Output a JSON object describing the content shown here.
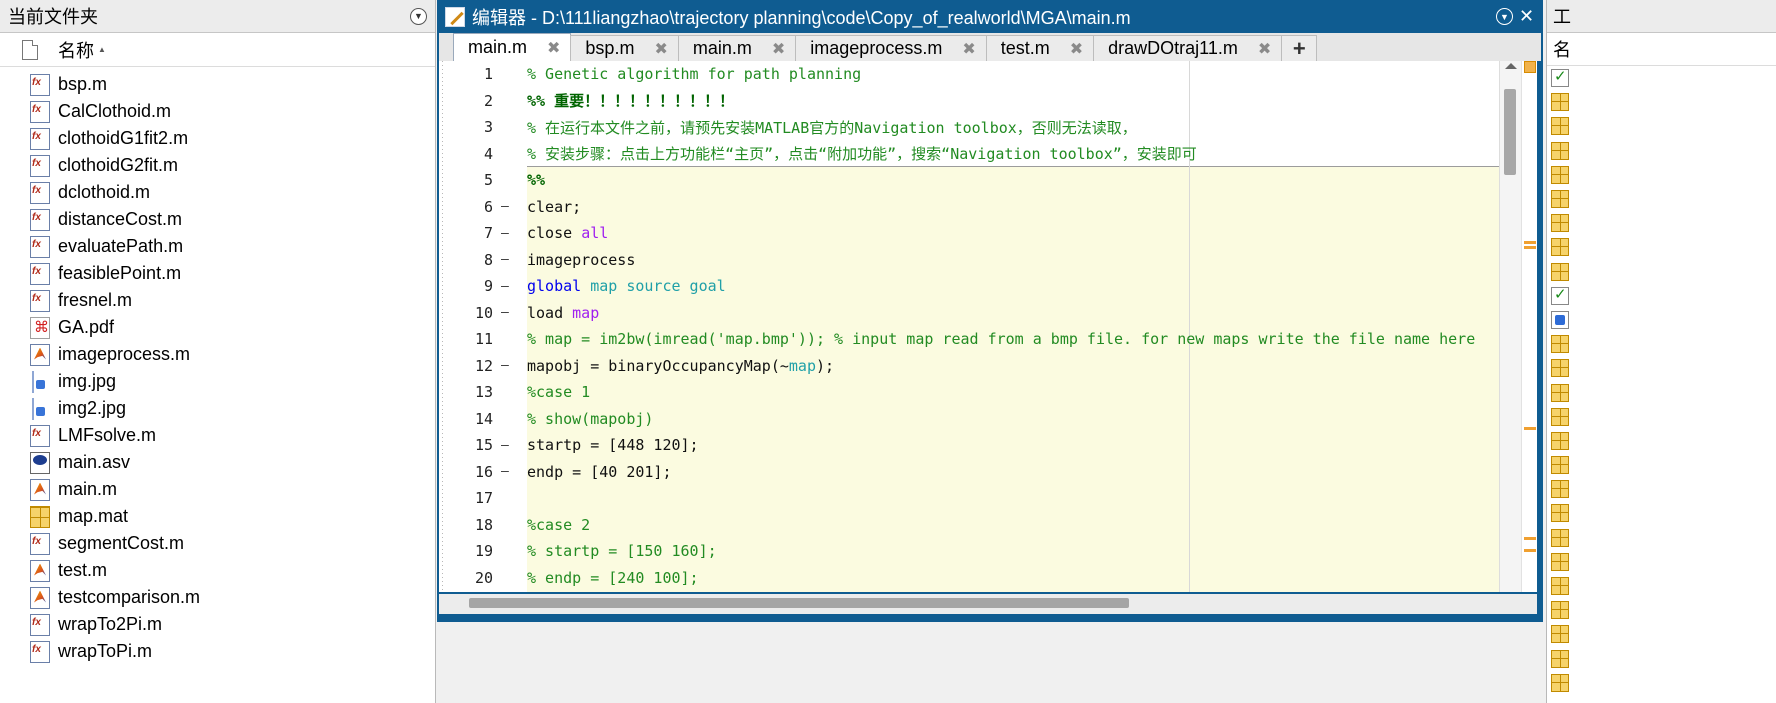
{
  "folder_panel": {
    "title": "当前文件夹",
    "column_name": "名称",
    "sort_arrow": "▲",
    "files": [
      {
        "name": "bsp.m",
        "icon": "function-file-icon"
      },
      {
        "name": "CalClothoid.m",
        "icon": "function-file-icon"
      },
      {
        "name": "clothoidG1fit2.m",
        "icon": "function-file-icon"
      },
      {
        "name": "clothoidG2fit.m",
        "icon": "function-file-icon"
      },
      {
        "name": "dclothoid.m",
        "icon": "function-file-icon"
      },
      {
        "name": "distanceCost.m",
        "icon": "function-file-icon"
      },
      {
        "name": "evaluatePath.m",
        "icon": "function-file-icon"
      },
      {
        "name": "feasiblePoint.m",
        "icon": "function-file-icon"
      },
      {
        "name": "fresnel.m",
        "icon": "function-file-icon"
      },
      {
        "name": "GA.pdf",
        "icon": "pdf-file-icon"
      },
      {
        "name": "imageprocess.m",
        "icon": "script-file-icon"
      },
      {
        "name": "img.jpg",
        "icon": "image-file-icon"
      },
      {
        "name": "img2.jpg",
        "icon": "image-file-icon"
      },
      {
        "name": "LMFsolve.m",
        "icon": "function-file-icon"
      },
      {
        "name": "main.asv",
        "icon": "autosave-file-icon"
      },
      {
        "name": "main.m",
        "icon": "script-file-icon"
      },
      {
        "name": "map.mat",
        "icon": "mat-file-icon"
      },
      {
        "name": "segmentCost.m",
        "icon": "function-file-icon"
      },
      {
        "name": "test.m",
        "icon": "script-file-icon"
      },
      {
        "name": "testcomparison.m",
        "icon": "script-file-icon"
      },
      {
        "name": "wrapTo2Pi.m",
        "icon": "function-file-icon"
      },
      {
        "name": "wrapToPi.m",
        "icon": "function-file-icon"
      }
    ]
  },
  "editor": {
    "title": "编辑器 - D:\\111liangzhao\\trajectory planning\\code\\Copy_of_realworld\\MGA\\main.m",
    "tabs": [
      {
        "label": "main.m",
        "active": true
      },
      {
        "label": "bsp.m",
        "active": false
      },
      {
        "label": "main.m",
        "active": false
      },
      {
        "label": "imageprocess.m",
        "active": false
      },
      {
        "label": "test.m",
        "active": false
      },
      {
        "label": "drawDOtraj11.m",
        "active": false
      }
    ],
    "tab_close_glyph": "✖",
    "tab_add_glyph": "+",
    "menu_glyph": "▼",
    "close_glyph": "✕",
    "lines": [
      {
        "n": "1",
        "dash": "",
        "tokens": [
          {
            "t": "% Genetic algorithm for path planning",
            "c": "cm"
          }
        ]
      },
      {
        "n": "2",
        "dash": "",
        "tokens": [
          {
            "t": "%% 重要！！！！！！！！！！",
            "c": "cell"
          }
        ]
      },
      {
        "n": "3",
        "dash": "",
        "tokens": [
          {
            "t": "% 在运行本文件之前，请预先安装MATLAB官方的Navigation toolbox，否则无法读取，",
            "c": "cm"
          }
        ]
      },
      {
        "n": "4",
        "dash": "",
        "tokens": [
          {
            "t": "% 安装步骤：点击上方功能栏“主页”，点击“附加功能”，搜索“Navigation toolbox”，安装即可",
            "c": "cm"
          }
        ]
      },
      {
        "n": "5",
        "dash": "",
        "tokens": [
          {
            "t": "%%",
            "c": "cell"
          }
        ]
      },
      {
        "n": "6",
        "dash": "—",
        "tokens": [
          {
            "t": "clear;",
            "c": "plain"
          }
        ]
      },
      {
        "n": "7",
        "dash": "—",
        "tokens": [
          {
            "t": "close ",
            "c": "plain"
          },
          {
            "t": "all",
            "c": "str"
          }
        ]
      },
      {
        "n": "8",
        "dash": "—",
        "tokens": [
          {
            "t": "imageprocess",
            "c": "plain"
          }
        ]
      },
      {
        "n": "9",
        "dash": "—",
        "tokens": [
          {
            "t": "global ",
            "c": "kw"
          },
          {
            "t": "map source goal",
            "c": "var"
          }
        ]
      },
      {
        "n": "10",
        "dash": "—",
        "tokens": [
          {
            "t": "load ",
            "c": "plain"
          },
          {
            "t": "map",
            "c": "str"
          }
        ]
      },
      {
        "n": "11",
        "dash": "",
        "tokens": [
          {
            "t": "% map = im2bw(imread('map.bmp')); % input map read from a bmp file. for new maps write the file name here",
            "c": "cm"
          }
        ]
      },
      {
        "n": "12",
        "dash": "—",
        "tokens": [
          {
            "t": "mapobj = binaryOccupancyMap(~",
            "c": "plain"
          },
          {
            "t": "map",
            "c": "var"
          },
          {
            "t": ");",
            "c": "plain"
          }
        ]
      },
      {
        "n": "13",
        "dash": "",
        "tokens": [
          {
            "t": "%case 1",
            "c": "cm"
          }
        ]
      },
      {
        "n": "14",
        "dash": "",
        "tokens": [
          {
            "t": "% show(mapobj)",
            "c": "cm"
          }
        ]
      },
      {
        "n": "15",
        "dash": "—",
        "tokens": [
          {
            "t": "startp = [448 120];",
            "c": "plain"
          }
        ]
      },
      {
        "n": "16",
        "dash": "—",
        "tokens": [
          {
            "t": "endp = [40 201];",
            "c": "plain"
          }
        ]
      },
      {
        "n": "17",
        "dash": "",
        "tokens": [
          {
            "t": "",
            "c": "plain"
          }
        ]
      },
      {
        "n": "18",
        "dash": "",
        "tokens": [
          {
            "t": "%case 2",
            "c": "cm"
          }
        ]
      },
      {
        "n": "19",
        "dash": "",
        "tokens": [
          {
            "t": "% startp = [150 160];",
            "c": "cm"
          }
        ]
      },
      {
        "n": "20",
        "dash": "",
        "tokens": [
          {
            "t": "% endp = [240 100];",
            "c": "cm"
          }
        ]
      }
    ]
  },
  "workspace": {
    "title": "工",
    "column_name": "名",
    "items": [
      "check",
      "mat",
      "mat",
      "mat",
      "mat",
      "mat",
      "mat",
      "mat",
      "mat",
      "check",
      "cube",
      "mat",
      "mat",
      "mat",
      "mat",
      "mat",
      "mat",
      "mat",
      "mat",
      "mat",
      "mat",
      "mat",
      "mat",
      "mat",
      "mat",
      "mat"
    ]
  }
}
